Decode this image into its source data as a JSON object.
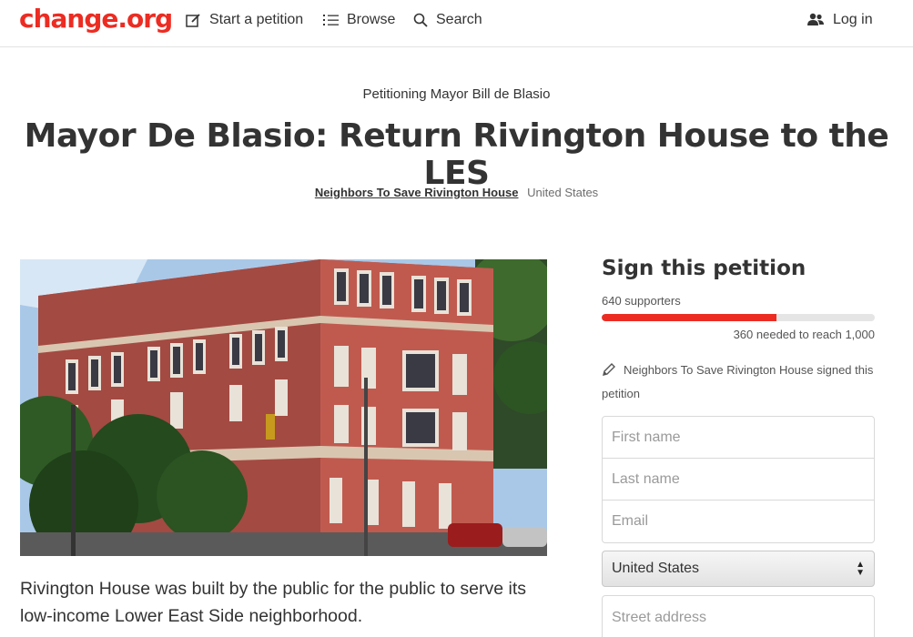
{
  "header": {
    "logo": "change.org",
    "nav": {
      "start": "Start a petition",
      "browse": "Browse",
      "search": "Search",
      "login": "Log in"
    }
  },
  "petition": {
    "target": "Petitioning Mayor Bill de Blasio",
    "title": "Mayor De Blasio: Return Rivington House to the LES",
    "author": "Neighbors To Save Rivington House",
    "location": "United States",
    "description": "Rivington House was built by the public for the public to serve its low-income Lower East Side neighborhood."
  },
  "sign": {
    "title": "Sign this petition",
    "supporters": "640 supporters",
    "progress_fraction": 0.64,
    "needed": "360 needed to reach 1,000",
    "signed_note": "Neighbors To Save Rivington House signed this petition",
    "fields": {
      "first_name": "First name",
      "last_name": "Last name",
      "email": "Email",
      "street": "Street address"
    },
    "country": "United States"
  },
  "colors": {
    "brand": "#ec2c22",
    "text": "#333333",
    "muted": "#6d6d6d"
  }
}
